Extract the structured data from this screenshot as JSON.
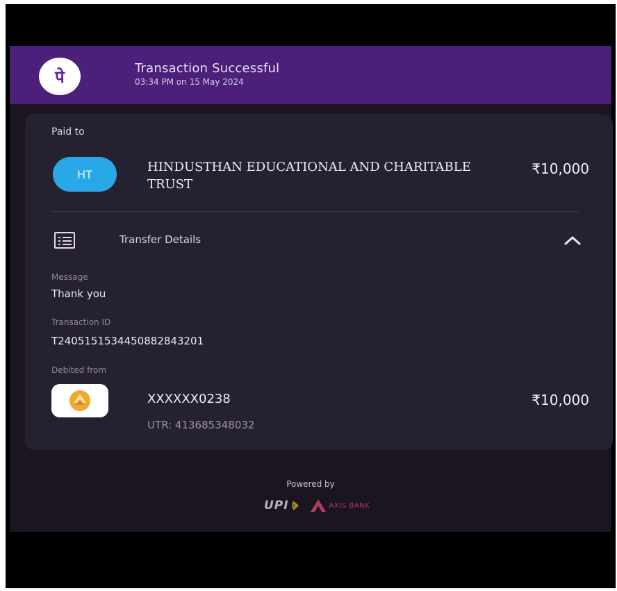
{
  "header": {
    "logo_glyph": "पे",
    "title": "Transaction Successful",
    "subtitle": "03:34 PM on 15 May 2024"
  },
  "payee": {
    "section_label": "Paid to",
    "initials": "HT",
    "name": "HINDUSTHAN EDUCATIONAL AND CHARITABLE TRUST",
    "amount": "₹10,000"
  },
  "transfer_details": {
    "title": "Transfer Details",
    "message_label": "Message",
    "message_value": "Thank you",
    "transaction_id_label": "Transaction ID",
    "transaction_id_value": "T2405151534450882843201",
    "debited_from_label": "Debited from",
    "account": "XXXXXX0238",
    "amount": "₹10,000",
    "utr": "UTR: 413685348032"
  },
  "footer": {
    "powered_by": "Powered by",
    "upi_label": "UPI",
    "bank_label": "AXIS BANK"
  },
  "colors": {
    "header_bg": "#4b1f7a",
    "screen_bg": "#1a1520",
    "card_bg": "#262130",
    "avatar_bg": "#29a8e8",
    "bank_logo_accent": "#f0a830",
    "axis_accent": "#b73a5e"
  },
  "icons": [
    "phonepe-logo",
    "list-icon",
    "chevron-up-icon",
    "bank-logo-icon",
    "upi-logo",
    "axis-bank-logo"
  ]
}
